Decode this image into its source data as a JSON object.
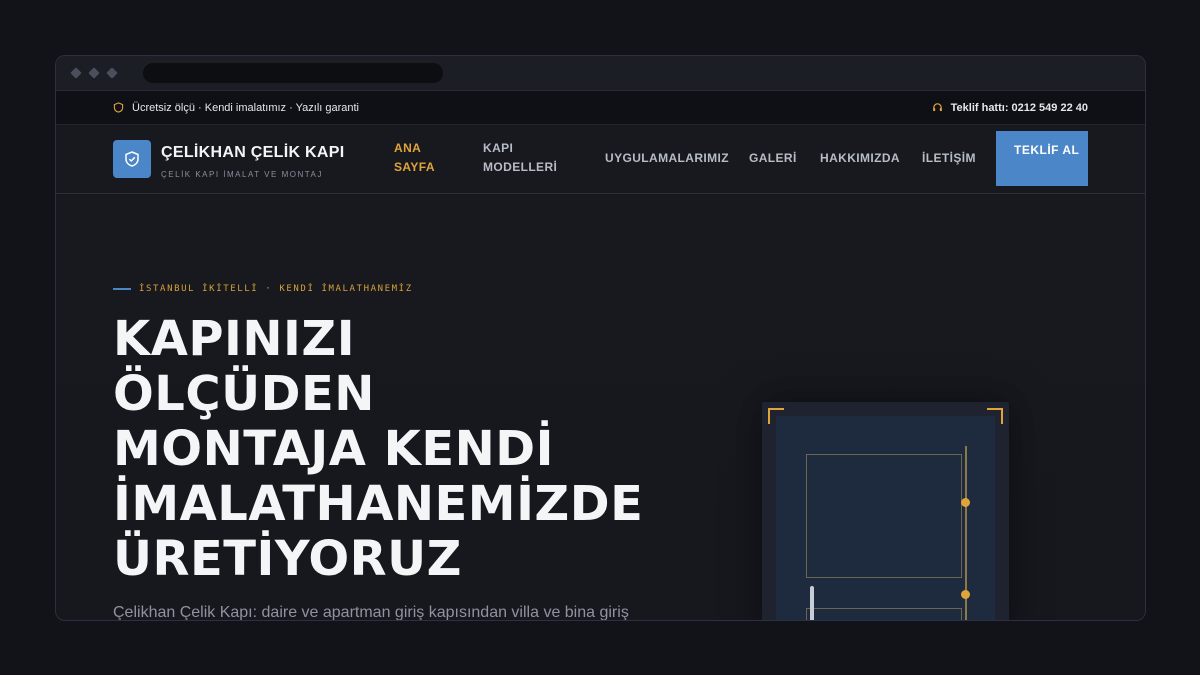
{
  "topbar": {
    "perks": "Ücretsiz ölçü · Kendi imalatımız · Yazılı garanti",
    "hotline": "Teklif hattı: 0212 549 22 40"
  },
  "brand": {
    "name": "ÇELİKHAN ÇELİK KAPI",
    "tagline": "ÇELİK KAPI İMALAT VE MONTAJ"
  },
  "nav": {
    "items": [
      {
        "label": "ANA SAYFA",
        "active": true
      },
      {
        "label": "KAPI MODELLERİ",
        "active": false
      },
      {
        "label": "UYGULAMALARIMIZ",
        "active": false
      },
      {
        "label": "GALERİ",
        "active": false
      },
      {
        "label": "HAKKIMIZDA",
        "active": false
      },
      {
        "label": "İLETİŞİM",
        "active": false
      }
    ],
    "cta": "TEKLİF AL"
  },
  "hero": {
    "eyebrow": "İSTANBUL İKİTELLİ · KENDİ İMALATHANEMİZ",
    "headline": "KAPINIZI ÖLÇÜDEN MONTAJA KENDİ İMALATHANEMİZDE ÜRETİYORUZ",
    "subtext": "Çelikhan Çelik Kapı: daire ve apartman giriş kapısından villa ve bina giriş"
  },
  "colors": {
    "accent": "#e0a43a",
    "brand_blue": "#4a86c8",
    "background": "#17191f"
  },
  "icons": {
    "perks": "shield-icon",
    "hotline": "headset-icon",
    "logo": "shield-check-icon"
  }
}
